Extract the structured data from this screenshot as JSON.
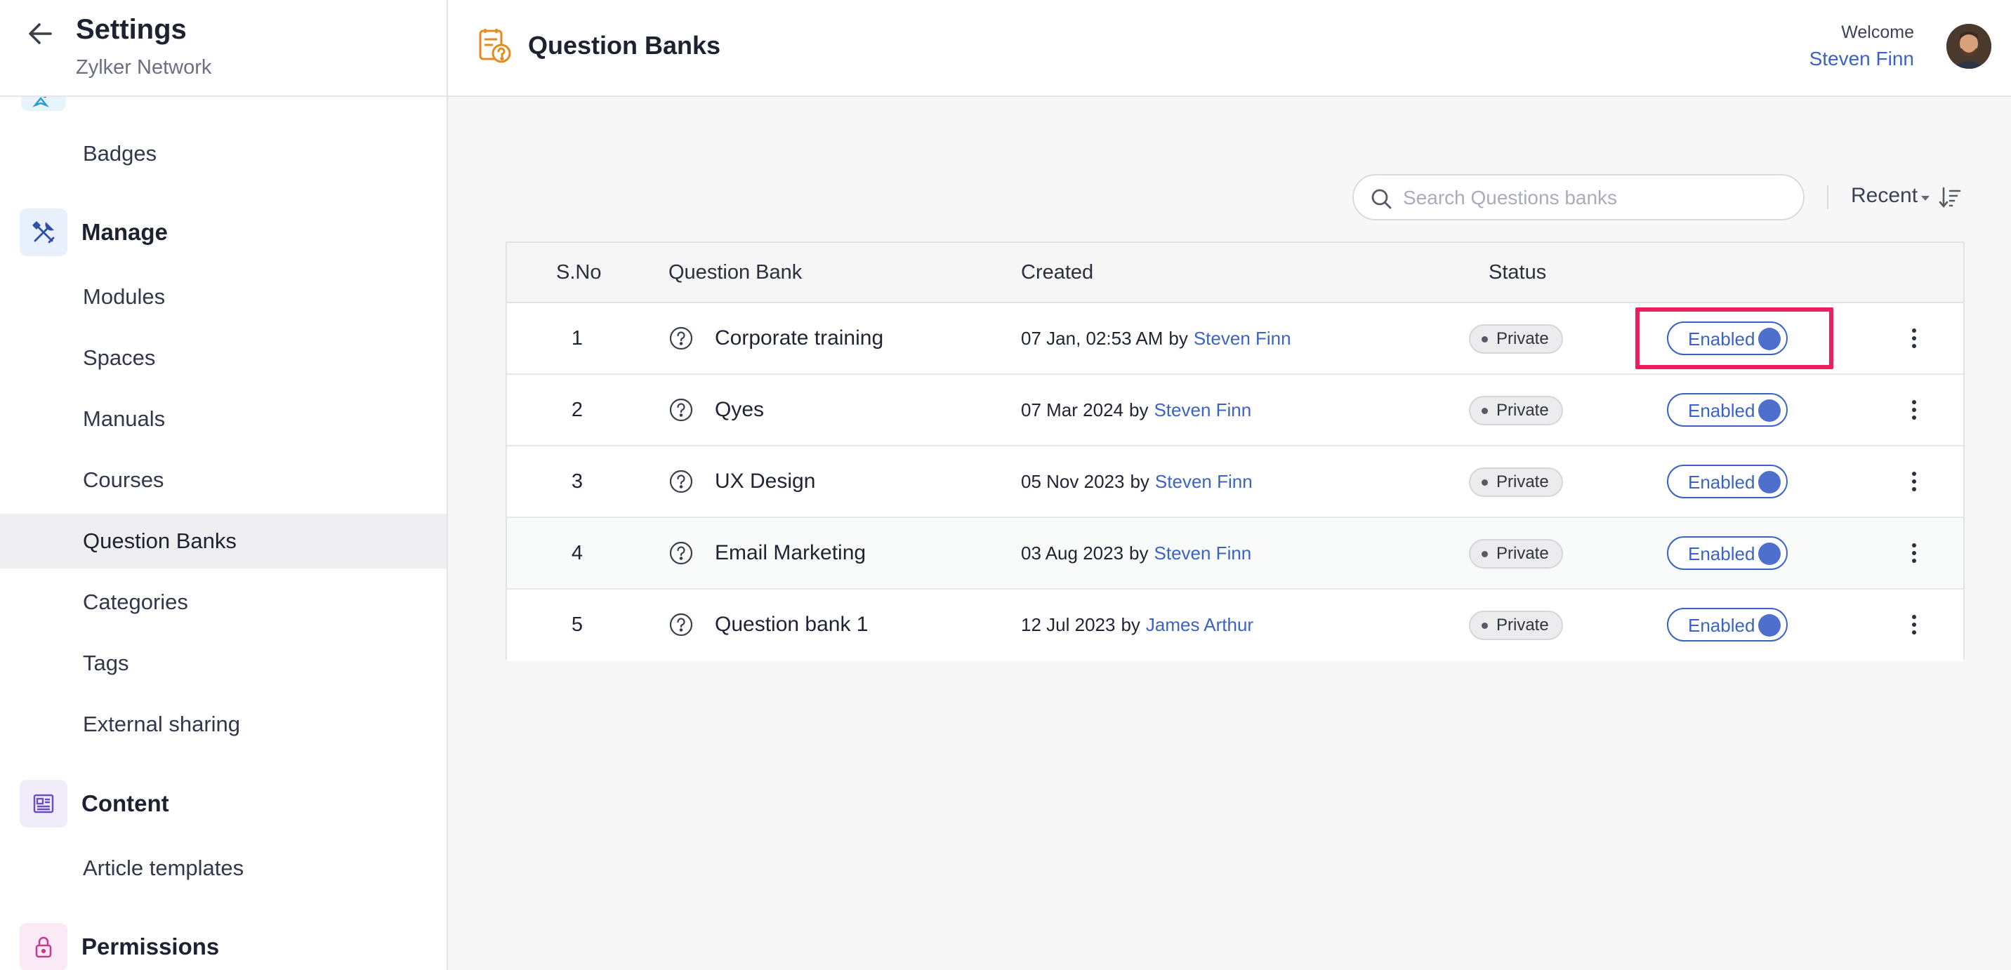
{
  "sidebar": {
    "title": "Settings",
    "subtitle": "Zylker Network",
    "items_top": [
      "Badges"
    ],
    "manage": {
      "label": "Manage",
      "items": [
        "Modules",
        "Spaces",
        "Manuals",
        "Courses",
        "Question Banks",
        "Categories",
        "Tags",
        "External sharing"
      ],
      "active": "Question Banks"
    },
    "content": {
      "label": "Content",
      "items": [
        "Article templates"
      ]
    },
    "permissions": {
      "label": "Permissions"
    }
  },
  "header": {
    "page_title": "Question Banks",
    "welcome": "Welcome",
    "user_name": "Steven Finn"
  },
  "toolbar": {
    "search_placeholder": "Search Questions banks",
    "sort_label": "Recent"
  },
  "table": {
    "columns": [
      "S.No",
      "Question Bank",
      "Created",
      "Status"
    ],
    "rows": [
      {
        "sno": "1",
        "name": "Corporate training",
        "created": "07 Jan, 02:53 AM",
        "by": "by",
        "author": "Steven Finn",
        "status": "Private",
        "toggle": "Enabled"
      },
      {
        "sno": "2",
        "name": "Qyes",
        "created": "07 Mar 2024",
        "by": "by",
        "author": "Steven Finn",
        "status": "Private",
        "toggle": "Enabled"
      },
      {
        "sno": "3",
        "name": "UX Design",
        "created": "05 Nov 2023",
        "by": "by",
        "author": "Steven Finn",
        "status": "Private",
        "toggle": "Enabled"
      },
      {
        "sno": "4",
        "name": "Email Marketing",
        "created": "03 Aug 2023",
        "by": "by",
        "author": "Steven Finn",
        "status": "Private",
        "toggle": "Enabled"
      },
      {
        "sno": "5",
        "name": "Question bank 1",
        "created": "12 Jul 2023",
        "by": "by",
        "author": "James Arthur",
        "status": "Private",
        "toggle": "Enabled"
      }
    ]
  },
  "colors": {
    "accent": "#3a63c4",
    "highlight": "#ee1e5e",
    "page_icon": "#e58a1f",
    "manage_tile": "#e8f1fb",
    "content_tile": "#f1ecfa",
    "permissions_tile": "#fbeaf5"
  },
  "icons": {
    "back": "arrow-left-icon",
    "page": "question-bank-icon",
    "search": "search-icon",
    "sort": "sort-descending-icon",
    "row": "question-circle-icon",
    "more": "vertical-dots-icon",
    "manage": "tools-icon",
    "content": "newspaper-icon",
    "permissions": "lock-icon"
  }
}
